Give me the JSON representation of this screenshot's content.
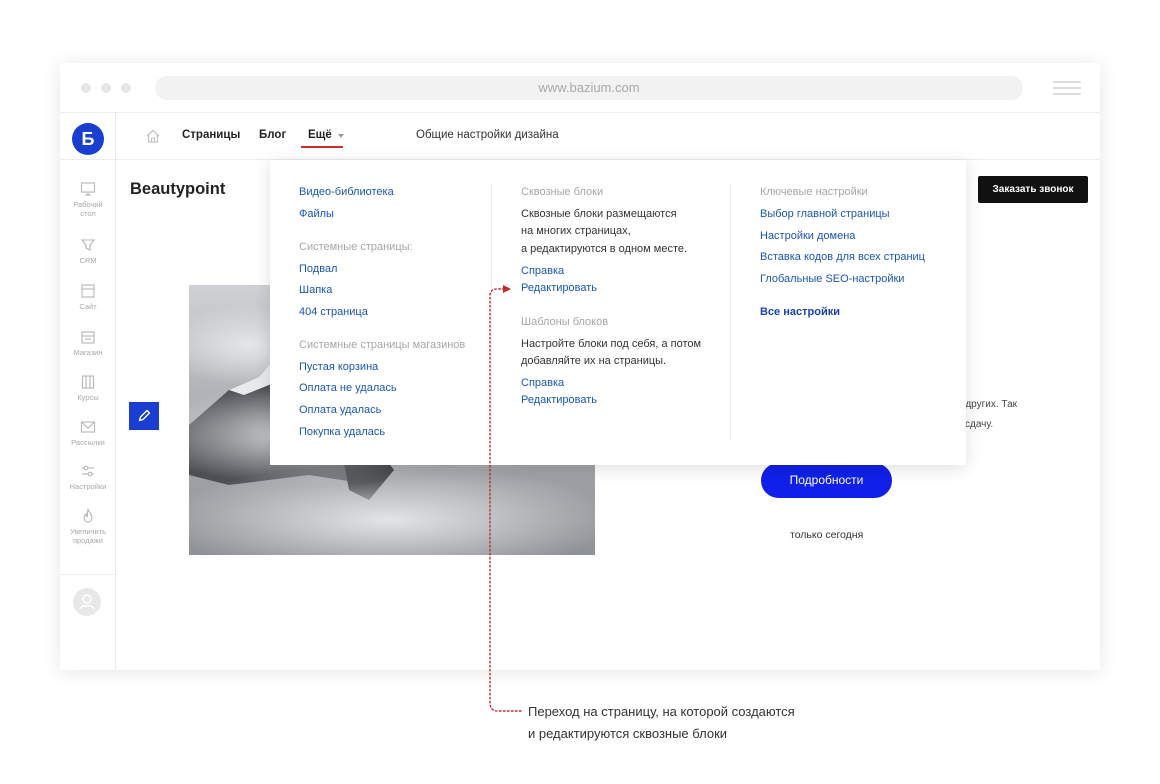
{
  "browser": {
    "url": "www.bazium.com",
    "menu_icon": "hamburger-icon"
  },
  "sidebar": {
    "logo": "Б",
    "items": [
      {
        "icon": "desktop-icon",
        "label_line1": "Рабочий",
        "label_line2": "стол"
      },
      {
        "icon": "crm-funnel-icon",
        "label_line1": "CRM",
        "label_line2": ""
      },
      {
        "icon": "site-icon",
        "label_line1": "Сайт",
        "label_line2": ""
      },
      {
        "icon": "store-icon",
        "label_line1": "Магазин",
        "label_line2": ""
      },
      {
        "icon": "courses-icon",
        "label_line1": "Курсы",
        "label_line2": ""
      },
      {
        "icon": "mail-icon",
        "label_line1": "Рассылки",
        "label_line2": ""
      },
      {
        "icon": "sliders-icon",
        "label_line1": "Настройки",
        "label_line2": ""
      },
      {
        "icon": "fire-icon",
        "label_line1": "Увеличить",
        "label_line2": "продажи"
      }
    ],
    "avatar_icon": "user-avatar-icon"
  },
  "topnav": {
    "home_icon": "home-icon",
    "pages": "Страницы",
    "blog": "Блог",
    "more": "Ещё",
    "design_settings": "Общие настройки дизайна"
  },
  "site": {
    "title": "Beautypoint",
    "cta": "Заказать звонок",
    "promo_line1": "е других. Так",
    "promo_line2": "ь сдачу.",
    "details_button": "Подробности",
    "today": "только сегодня"
  },
  "dropdown": {
    "col1": {
      "links_top": [
        "Видео-библиотека",
        "Файлы"
      ],
      "system_pages_heading": "Системные страницы:",
      "system_pages": [
        "Подвал",
        "Шапка",
        "404 страница"
      ],
      "shop_pages_heading": "Системные страницы магазинов",
      "shop_pages": [
        "Пустая корзина",
        "Оплата не удалась",
        "Оплата удалась",
        "Покупка удалась"
      ]
    },
    "col2": {
      "global_heading": "Сквозные блоки",
      "global_text_1": "Сквозные блоки размещаются",
      "global_text_2": "на многих страницах,",
      "global_text_3": "а редактируются в одном месте.",
      "global_help": "Справка",
      "global_edit": "Редактировать",
      "templates_heading": "Шаблоны блоков",
      "templates_text_1": "Настройте блоки под себя, а потом",
      "templates_text_2": "добавляйте их на страницы.",
      "templates_help": "Справка",
      "templates_edit": "Редактировать"
    },
    "col3": {
      "heading": "Ключевые настройки",
      "links": [
        "Выбор главной страницы",
        "Настройки домена",
        "Вставка кодов для всех страниц",
        "Глобальные SEO-настройки"
      ],
      "all_settings": "Все настройки"
    }
  },
  "annotation": {
    "line1": "Переход на страницу, на которой создаются",
    "line2": "и редактируются сквозные блоки",
    "color": "#c62828"
  },
  "colors": {
    "brand_blue": "#1a3fd0",
    "link_blue": "#1b55b5",
    "accent_red": "#d62828",
    "button_blue": "#1020e8"
  }
}
